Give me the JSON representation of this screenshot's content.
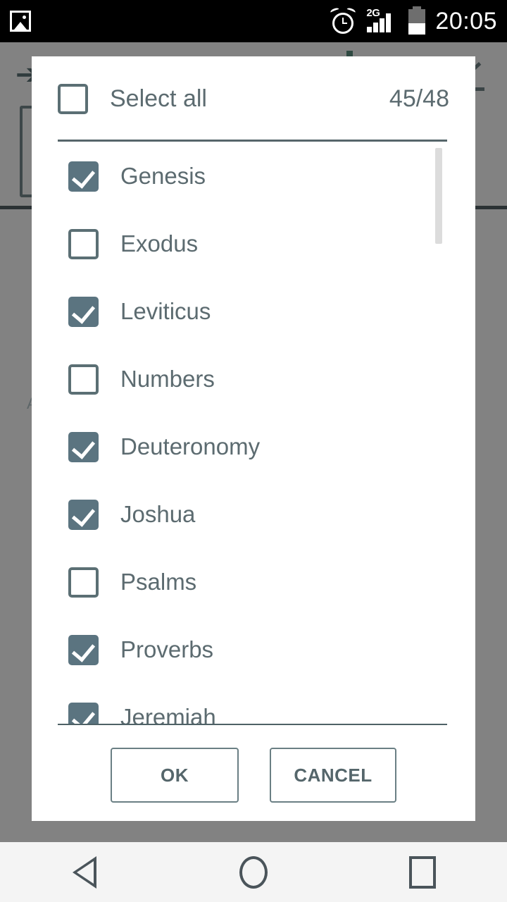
{
  "status_bar": {
    "gallery_icon": "gallery-icon",
    "alarm_icon": "alarm-clock-icon",
    "network_label": "2G",
    "signal_icon": "signal-bars-icon",
    "battery_icon": "battery-icon",
    "time": "20:05"
  },
  "background_app": {
    "back_arrow_icon": "back-arrow-icon",
    "share_icon": "share-icon",
    "card_letter": "A"
  },
  "dialog": {
    "select_all": {
      "label": "Select all",
      "checked": false,
      "count": "45/48"
    },
    "items": [
      {
        "label": "Genesis",
        "checked": true
      },
      {
        "label": "Exodus",
        "checked": false
      },
      {
        "label": "Leviticus",
        "checked": true
      },
      {
        "label": "Numbers",
        "checked": false
      },
      {
        "label": "Deuteronomy",
        "checked": true
      },
      {
        "label": "Joshua",
        "checked": true
      },
      {
        "label": "Psalms",
        "checked": false
      },
      {
        "label": "Proverbs",
        "checked": true
      },
      {
        "label": "Jeremiah",
        "checked": true
      }
    ],
    "buttons": {
      "ok": "OK",
      "cancel": "CANCEL"
    }
  },
  "nav_bar": {
    "back": "back-nav-icon",
    "home": "home-nav-icon",
    "recents": "recents-nav-icon"
  },
  "colors": {
    "accent": "#5b7480",
    "text": "#5c6b70",
    "divider": "#56666a",
    "scrim": "#828282",
    "dialog_bg": "#ffffff"
  }
}
